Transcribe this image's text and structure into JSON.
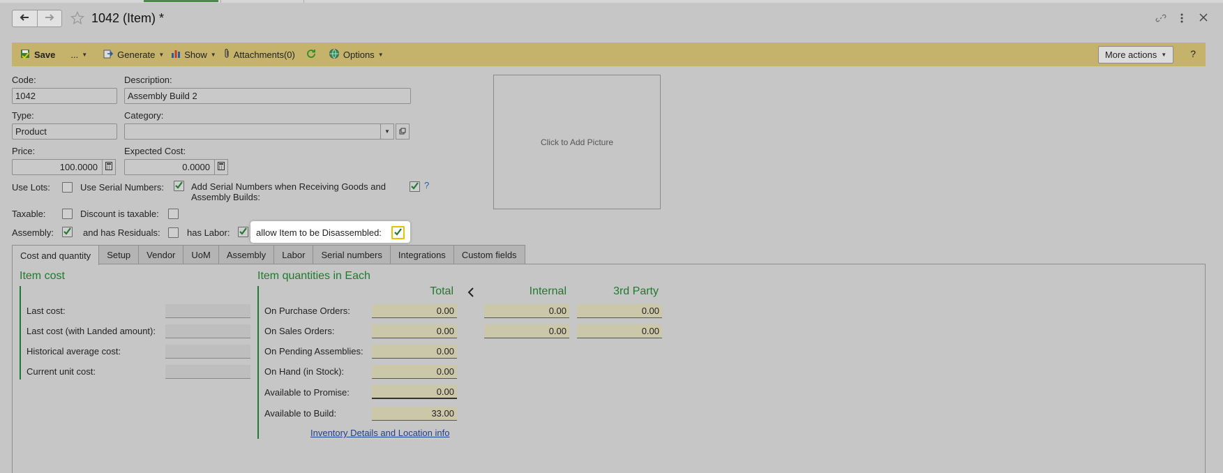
{
  "header": {
    "title": "1042 (Item) *",
    "back_icon": "arrow-left-icon",
    "forward_icon": "arrow-right-icon",
    "star_icon": "star-outline-icon",
    "link_icon": "link-icon",
    "menu_icon": "kebab-menu-icon",
    "close_icon": "close-icon"
  },
  "toolbar": {
    "save_label": "Save",
    "more_label": "...",
    "generate_label": "Generate",
    "show_label": "Show",
    "attachments_label": "Attachments(0)",
    "options_label": "Options",
    "more_actions_label": "More actions",
    "help_label": "?"
  },
  "form": {
    "code_label": "Code:",
    "code_value": "1042",
    "description_label": "Description:",
    "description_value": "Assembly Build 2",
    "type_label": "Type:",
    "type_value": "Product",
    "category_label": "Category:",
    "category_value": "",
    "price_label": "Price:",
    "price_value": "100.0000",
    "expected_cost_label": "Expected Cost:",
    "expected_cost_value": "0.0000",
    "use_lots_label": "Use Lots:",
    "use_lots": false,
    "use_serial_label": "Use Serial Numbers:",
    "use_serial": true,
    "add_serial_label_1": "Add Serial Numbers when Receiving Goods and",
    "add_serial_label_2": "Assembly Builds:",
    "add_serial": true,
    "add_serial_help": "?",
    "taxable_label": "Taxable:",
    "taxable": false,
    "discount_taxable_label": "Discount is taxable:",
    "discount_taxable": false,
    "assembly_label": "Assembly:",
    "assembly": true,
    "residuals_label": "and has Residuals:",
    "residuals": false,
    "labor_label": "has Labor:",
    "labor": true,
    "disassemble_label": "allow Item to be Disassembled:",
    "disassemble": true
  },
  "picture": {
    "label": "Click to Add Picture"
  },
  "tabs": [
    {
      "label": "Cost and quantity",
      "active": true
    },
    {
      "label": "Setup"
    },
    {
      "label": "Vendor"
    },
    {
      "label": "UoM"
    },
    {
      "label": "Assembly"
    },
    {
      "label": "Labor"
    },
    {
      "label": "Serial numbers"
    },
    {
      "label": "Integrations"
    },
    {
      "label": "Custom fields"
    }
  ],
  "item_cost": {
    "title": "Item cost",
    "rows": [
      {
        "label": "Last cost:",
        "value": ""
      },
      {
        "label": "Last cost (with Landed amount):",
        "value": ""
      },
      {
        "label": "Historical average cost:",
        "value": ""
      },
      {
        "label": "Current unit cost:",
        "value": ""
      }
    ]
  },
  "item_qty": {
    "title": "Item quantities in Each",
    "col_total": "Total",
    "col_internal": "Internal",
    "col_third": "3rd Party",
    "rows": [
      {
        "label": "On Purchase Orders:",
        "total": "0.00",
        "internal": "0.00",
        "third": "0.00"
      },
      {
        "label": "On Sales Orders:",
        "total": "0.00",
        "internal": "0.00",
        "third": "0.00"
      },
      {
        "label": "On Pending Assemblies:",
        "total": "0.00"
      },
      {
        "label": "On Hand (in Stock):",
        "total": "0.00"
      },
      {
        "label": "Available to Promise:",
        "total": "0.00"
      },
      {
        "label": "Available to Build:",
        "total": "33.00"
      }
    ],
    "link_label": "Inventory Details and Location info"
  }
}
